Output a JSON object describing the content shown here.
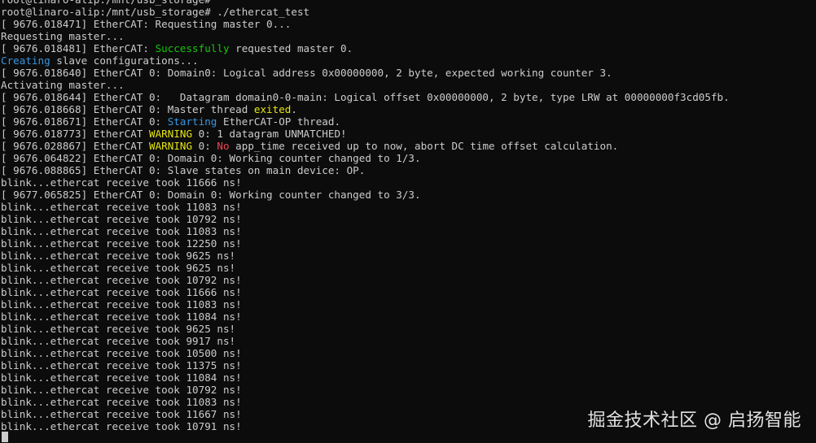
{
  "terminal": {
    "colors": {
      "background": "#0c0c0c",
      "default": "#cccccc",
      "green": "#16c60c",
      "cyan": "#3a96dd",
      "yellow": "#e5e510",
      "red": "#e74856"
    },
    "lines": [
      [
        {
          "t": "root@linaro-alip:/mnt/usb_storage#"
        }
      ],
      [
        {
          "t": "root@linaro-alip:/mnt/usb_storage# ./ethercat_test"
        }
      ],
      [
        {
          "t": "[ 9676.018471] EtherCAT: Requesting master 0..."
        }
      ],
      [
        {
          "t": "Requesting master..."
        }
      ],
      [
        {
          "t": "[ 9676.018481] EtherCAT: "
        },
        {
          "t": "Successfully",
          "c": "#16c60c"
        },
        {
          "t": " requested master 0."
        }
      ],
      [
        {
          "t": "Creating",
          "c": "#3a96dd"
        },
        {
          "t": " slave configurations..."
        }
      ],
      [
        {
          "t": "[ 9676.018640] EtherCAT 0: Domain0: Logical address 0x00000000, 2 byte, expected working counter 3."
        }
      ],
      [
        {
          "t": "Activating master..."
        }
      ],
      [
        {
          "t": "[ 9676.018644] EtherCAT 0:   Datagram domain0-0-main: Logical offset 0x00000000, 2 byte, type LRW at 00000000f3cd05fb."
        }
      ],
      [
        {
          "t": "[ 9676.018668] EtherCAT 0: Master thread "
        },
        {
          "t": "exited",
          "c": "#e5e510"
        },
        {
          "t": "."
        }
      ],
      [
        {
          "t": "[ 9676.018671] EtherCAT 0: "
        },
        {
          "t": "Starting",
          "c": "#3a96dd"
        },
        {
          "t": " EtherCAT-OP thread."
        }
      ],
      [
        {
          "t": "[ 9676.018773] EtherCAT "
        },
        {
          "t": "WARNING",
          "c": "#e5e510"
        },
        {
          "t": " 0: 1 datagram UNMATCHED!"
        }
      ],
      [
        {
          "t": "[ 9676.028867] EtherCAT "
        },
        {
          "t": "WARNING",
          "c": "#e5e510"
        },
        {
          "t": " 0: "
        },
        {
          "t": "No",
          "c": "#e74856"
        },
        {
          "t": " app_time received up to now, abort DC time offset calculation."
        }
      ],
      [
        {
          "t": "[ 9676.064822] EtherCAT 0: Domain 0: Working counter changed to 1/3."
        }
      ],
      [
        {
          "t": "[ 9676.088865] EtherCAT 0: Slave states on main device: OP."
        }
      ],
      [
        {
          "t": "blink...ethercat receive took 11666 ns!"
        }
      ],
      [
        {
          "t": "[ 9677.065825] EtherCAT 0: Domain 0: Working counter changed to 3/3."
        }
      ],
      [
        {
          "t": "blink...ethercat receive took 11083 ns!"
        }
      ],
      [
        {
          "t": "blink...ethercat receive took 10792 ns!"
        }
      ],
      [
        {
          "t": "blink...ethercat receive took 11083 ns!"
        }
      ],
      [
        {
          "t": "blink...ethercat receive took 12250 ns!"
        }
      ],
      [
        {
          "t": "blink...ethercat receive took 9625 ns!"
        }
      ],
      [
        {
          "t": "blink...ethercat receive took 9625 ns!"
        }
      ],
      [
        {
          "t": "blink...ethercat receive took 10792 ns!"
        }
      ],
      [
        {
          "t": "blink...ethercat receive took 11666 ns!"
        }
      ],
      [
        {
          "t": "blink...ethercat receive took 11083 ns!"
        }
      ],
      [
        {
          "t": "blink...ethercat receive took 11084 ns!"
        }
      ],
      [
        {
          "t": "blink...ethercat receive took 9625 ns!"
        }
      ],
      [
        {
          "t": "blink...ethercat receive took 9917 ns!"
        }
      ],
      [
        {
          "t": "blink...ethercat receive took 10500 ns!"
        }
      ],
      [
        {
          "t": "blink...ethercat receive took 11375 ns!"
        }
      ],
      [
        {
          "t": "blink...ethercat receive took 11084 ns!"
        }
      ],
      [
        {
          "t": "blink...ethercat receive took 10792 ns!"
        }
      ],
      [
        {
          "t": "blink...ethercat receive took 11083 ns!"
        }
      ],
      [
        {
          "t": "blink...ethercat receive took 11667 ns!"
        }
      ],
      [
        {
          "t": "blink...ethercat receive took 10791 ns!"
        }
      ]
    ]
  },
  "watermark": {
    "text": "掘金技术社区 @ 启扬智能"
  }
}
